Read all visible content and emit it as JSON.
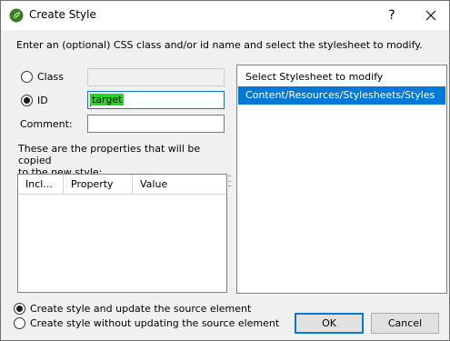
{
  "window": {
    "title": "Create Style",
    "help_label": "?"
  },
  "instruction": "Enter an (optional) CSS class and/or id name and select the stylesheet to modify.",
  "selector": {
    "class_label": "Class",
    "class_value": "",
    "id_label": "ID",
    "id_value": "target",
    "selected": "ID",
    "comment_label": "Comment:",
    "comment_value": ""
  },
  "properties": {
    "description_line1": "These are the properties that will be copied",
    "description_line2": "to the new style:",
    "columns": [
      "Incl...",
      "Property",
      "Value"
    ],
    "rows": []
  },
  "stylesheets": {
    "items": [
      "Select Stylesheet to modify",
      "Content/Resources/Stylesheets/Styles"
    ],
    "selected_index": 1
  },
  "mode": {
    "option_update": "Create style and update the source element",
    "option_no_update": "Create style without updating the source element",
    "selected": "option_update"
  },
  "buttons": {
    "ok": "OK",
    "cancel": "Cancel"
  },
  "colors": {
    "accent": "#0078d7",
    "highlight": "#22d822"
  }
}
